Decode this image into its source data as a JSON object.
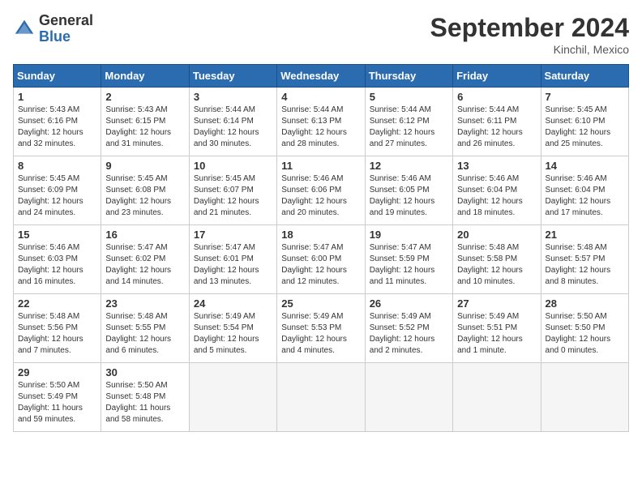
{
  "header": {
    "logo_general": "General",
    "logo_blue": "Blue",
    "month_title": "September 2024",
    "location": "Kinchil, Mexico"
  },
  "days_of_week": [
    "Sunday",
    "Monday",
    "Tuesday",
    "Wednesday",
    "Thursday",
    "Friday",
    "Saturday"
  ],
  "weeks": [
    [
      {
        "day": "1",
        "info": "Sunrise: 5:43 AM\nSunset: 6:16 PM\nDaylight: 12 hours\nand 32 minutes."
      },
      {
        "day": "2",
        "info": "Sunrise: 5:43 AM\nSunset: 6:15 PM\nDaylight: 12 hours\nand 31 minutes."
      },
      {
        "day": "3",
        "info": "Sunrise: 5:44 AM\nSunset: 6:14 PM\nDaylight: 12 hours\nand 30 minutes."
      },
      {
        "day": "4",
        "info": "Sunrise: 5:44 AM\nSunset: 6:13 PM\nDaylight: 12 hours\nand 28 minutes."
      },
      {
        "day": "5",
        "info": "Sunrise: 5:44 AM\nSunset: 6:12 PM\nDaylight: 12 hours\nand 27 minutes."
      },
      {
        "day": "6",
        "info": "Sunrise: 5:44 AM\nSunset: 6:11 PM\nDaylight: 12 hours\nand 26 minutes."
      },
      {
        "day": "7",
        "info": "Sunrise: 5:45 AM\nSunset: 6:10 PM\nDaylight: 12 hours\nand 25 minutes."
      }
    ],
    [
      {
        "day": "8",
        "info": "Sunrise: 5:45 AM\nSunset: 6:09 PM\nDaylight: 12 hours\nand 24 minutes."
      },
      {
        "day": "9",
        "info": "Sunrise: 5:45 AM\nSunset: 6:08 PM\nDaylight: 12 hours\nand 23 minutes."
      },
      {
        "day": "10",
        "info": "Sunrise: 5:45 AM\nSunset: 6:07 PM\nDaylight: 12 hours\nand 21 minutes."
      },
      {
        "day": "11",
        "info": "Sunrise: 5:46 AM\nSunset: 6:06 PM\nDaylight: 12 hours\nand 20 minutes."
      },
      {
        "day": "12",
        "info": "Sunrise: 5:46 AM\nSunset: 6:05 PM\nDaylight: 12 hours\nand 19 minutes."
      },
      {
        "day": "13",
        "info": "Sunrise: 5:46 AM\nSunset: 6:04 PM\nDaylight: 12 hours\nand 18 minutes."
      },
      {
        "day": "14",
        "info": "Sunrise: 5:46 AM\nSunset: 6:04 PM\nDaylight: 12 hours\nand 17 minutes."
      }
    ],
    [
      {
        "day": "15",
        "info": "Sunrise: 5:46 AM\nSunset: 6:03 PM\nDaylight: 12 hours\nand 16 minutes."
      },
      {
        "day": "16",
        "info": "Sunrise: 5:47 AM\nSunset: 6:02 PM\nDaylight: 12 hours\nand 14 minutes."
      },
      {
        "day": "17",
        "info": "Sunrise: 5:47 AM\nSunset: 6:01 PM\nDaylight: 12 hours\nand 13 minutes."
      },
      {
        "day": "18",
        "info": "Sunrise: 5:47 AM\nSunset: 6:00 PM\nDaylight: 12 hours\nand 12 minutes."
      },
      {
        "day": "19",
        "info": "Sunrise: 5:47 AM\nSunset: 5:59 PM\nDaylight: 12 hours\nand 11 minutes."
      },
      {
        "day": "20",
        "info": "Sunrise: 5:48 AM\nSunset: 5:58 PM\nDaylight: 12 hours\nand 10 minutes."
      },
      {
        "day": "21",
        "info": "Sunrise: 5:48 AM\nSunset: 5:57 PM\nDaylight: 12 hours\nand 8 minutes."
      }
    ],
    [
      {
        "day": "22",
        "info": "Sunrise: 5:48 AM\nSunset: 5:56 PM\nDaylight: 12 hours\nand 7 minutes."
      },
      {
        "day": "23",
        "info": "Sunrise: 5:48 AM\nSunset: 5:55 PM\nDaylight: 12 hours\nand 6 minutes."
      },
      {
        "day": "24",
        "info": "Sunrise: 5:49 AM\nSunset: 5:54 PM\nDaylight: 12 hours\nand 5 minutes."
      },
      {
        "day": "25",
        "info": "Sunrise: 5:49 AM\nSunset: 5:53 PM\nDaylight: 12 hours\nand 4 minutes."
      },
      {
        "day": "26",
        "info": "Sunrise: 5:49 AM\nSunset: 5:52 PM\nDaylight: 12 hours\nand 2 minutes."
      },
      {
        "day": "27",
        "info": "Sunrise: 5:49 AM\nSunset: 5:51 PM\nDaylight: 12 hours\nand 1 minute."
      },
      {
        "day": "28",
        "info": "Sunrise: 5:50 AM\nSunset: 5:50 PM\nDaylight: 12 hours\nand 0 minutes."
      }
    ],
    [
      {
        "day": "29",
        "info": "Sunrise: 5:50 AM\nSunset: 5:49 PM\nDaylight: 11 hours\nand 59 minutes."
      },
      {
        "day": "30",
        "info": "Sunrise: 5:50 AM\nSunset: 5:48 PM\nDaylight: 11 hours\nand 58 minutes."
      },
      {
        "day": "",
        "info": ""
      },
      {
        "day": "",
        "info": ""
      },
      {
        "day": "",
        "info": ""
      },
      {
        "day": "",
        "info": ""
      },
      {
        "day": "",
        "info": ""
      }
    ]
  ]
}
